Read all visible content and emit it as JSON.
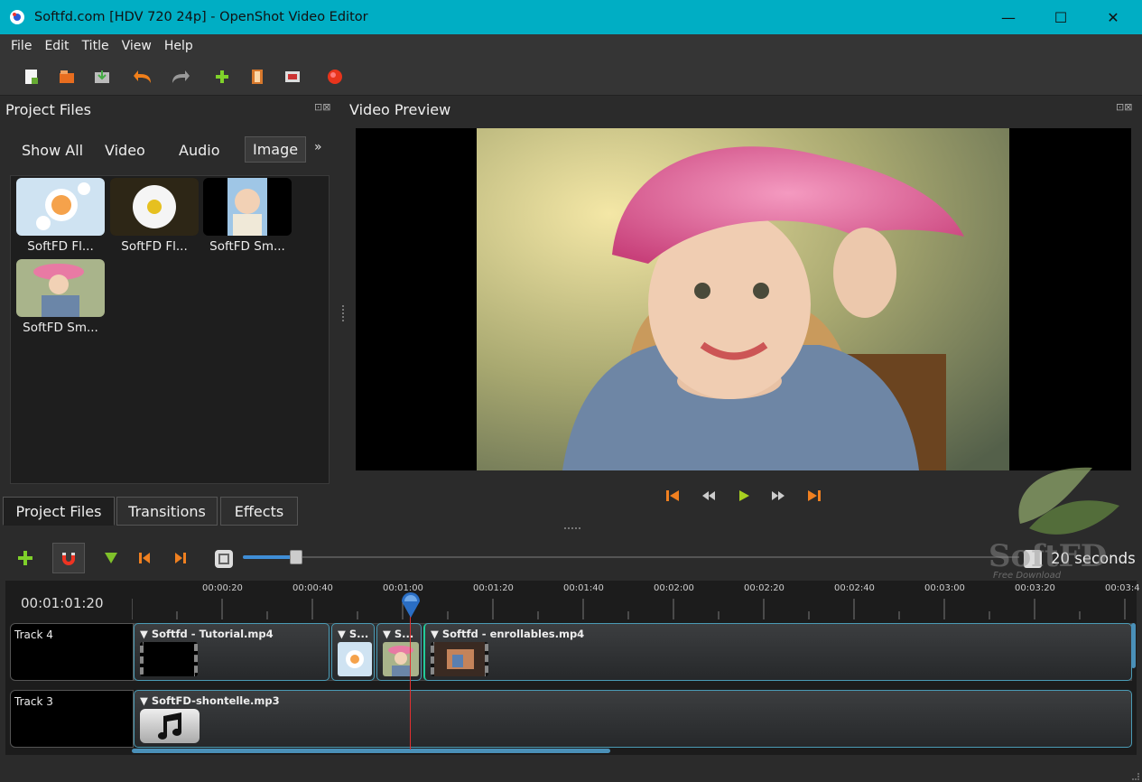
{
  "window": {
    "title": "Softfd.com [HDV 720 24p] - OpenShot Video Editor",
    "minimize": "—",
    "maximize": "☐",
    "close": "✕"
  },
  "menu": [
    "File",
    "Edit",
    "Title",
    "View",
    "Help"
  ],
  "project_files": {
    "title": "Project Files",
    "filters": [
      "Show All",
      "Video",
      "Audio",
      "Image"
    ],
    "selected_filter": "Image",
    "more": "»",
    "files": [
      "SoftFD Fl...",
      "SoftFD Fl...",
      "SoftFD Sm...",
      "SoftFD Sm..."
    ]
  },
  "bottom_tabs": [
    "Project Files",
    "Transitions",
    "Effects"
  ],
  "preview": {
    "title": "Video Preview"
  },
  "timeline": {
    "time": "00:01:01:20",
    "zoom_label": "20 seconds",
    "ruler": [
      "00:00:20",
      "00:00:40",
      "00:01:00",
      "00:01:20",
      "00:01:40",
      "00:02:00",
      "00:02:20",
      "00:02:40",
      "00:03:00",
      "00:03:20",
      "00:03:4"
    ],
    "tracks": [
      {
        "name": "Track 4",
        "clips": [
          "Softfd - Tutorial.mp4",
          "S...",
          "S...",
          "Softfd - enrollables.mp4"
        ]
      },
      {
        "name": "Track 3",
        "clips": [
          "SoftFD-shontelle.mp3"
        ]
      }
    ]
  },
  "watermark": {
    "name": "SoftFD",
    "tagline": "Free Download"
  },
  "colors": {
    "titlebar": "#00aec4",
    "accent": "#4a9bb5",
    "playhead": "#e03030"
  }
}
